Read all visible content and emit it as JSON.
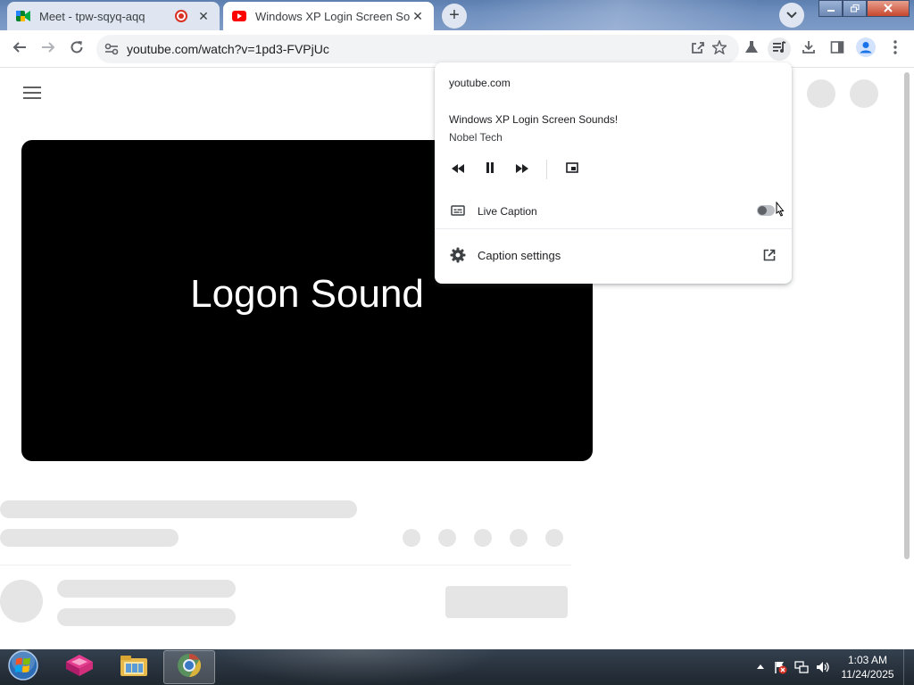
{
  "browser": {
    "tabs": [
      {
        "title": "Meet - tpw-sqyq-aqq",
        "favicon": "google-meet-icon",
        "recording": true,
        "active": false
      },
      {
        "title": "Windows XP Login Screen Sounds!",
        "favicon": "youtube-icon",
        "active": true
      }
    ],
    "new_tab_label": "+",
    "close_label": "✕",
    "address": {
      "url": "youtube.com/watch?v=1pd3-FVPjUc"
    }
  },
  "page": {
    "video": {
      "caption_text": "Logon Sound",
      "background": "#000000"
    }
  },
  "media_popup": {
    "origin": "youtube.com",
    "track_title": "Windows XP Login Screen Sounds!",
    "artist": "Nobel Tech",
    "controls": [
      "previous-track-icon",
      "pause-icon",
      "next-track-icon",
      "picture-in-picture-icon"
    ],
    "live_caption": {
      "label": "Live Caption",
      "enabled": false
    },
    "caption_settings": {
      "label": "Caption settings"
    }
  },
  "taskbar": {
    "apps": [
      "start-orb",
      "app-icon",
      "file-explorer-icon",
      "chrome-icon"
    ],
    "active_app": "chrome-icon",
    "clock": {
      "time": "1:03 AM",
      "date": "11/24/2025"
    }
  },
  "colors": {
    "accent": "#1a73e8",
    "youtube_red": "#ff0000",
    "skeleton": "#e5e5e5",
    "recording_red": "#d93025"
  }
}
